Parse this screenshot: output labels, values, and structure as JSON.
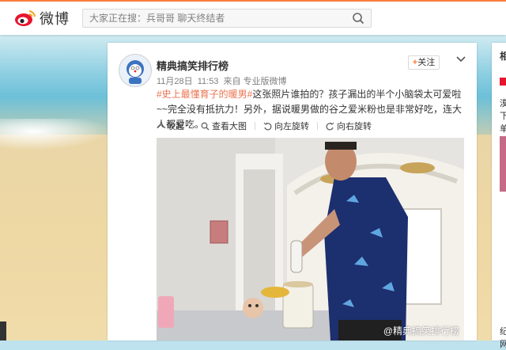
{
  "site": {
    "logo_text": "微博",
    "brand_color": "#fa7d3c"
  },
  "search": {
    "placeholder": "大家正在搜：兵哥哥 聊天终结者"
  },
  "post": {
    "username": "精典搞笑排行榜",
    "date": "11月28日",
    "time": "11:53",
    "source_prefix": "来自",
    "source": "专业版微博",
    "follow_label": "关注",
    "hashtag": "#史上最懂育子的暖男#",
    "text": "这张照片谁拍的？孩子漏出的半个小脑袋太可爱啦~~完全没有抵抗力！另外，据说暖男做的谷之爱米粉也是非常好吃，连大人都爱吃。",
    "actions": [
      "收起",
      "查看大图",
      "向左旋转",
      "向右旋转"
    ],
    "photo_watermark": "@精典搞笑排行榜"
  },
  "side": {
    "title_char": "相",
    "lines": [
      "漠",
      "下",
      "单",
      "纪",
      "网"
    ]
  }
}
